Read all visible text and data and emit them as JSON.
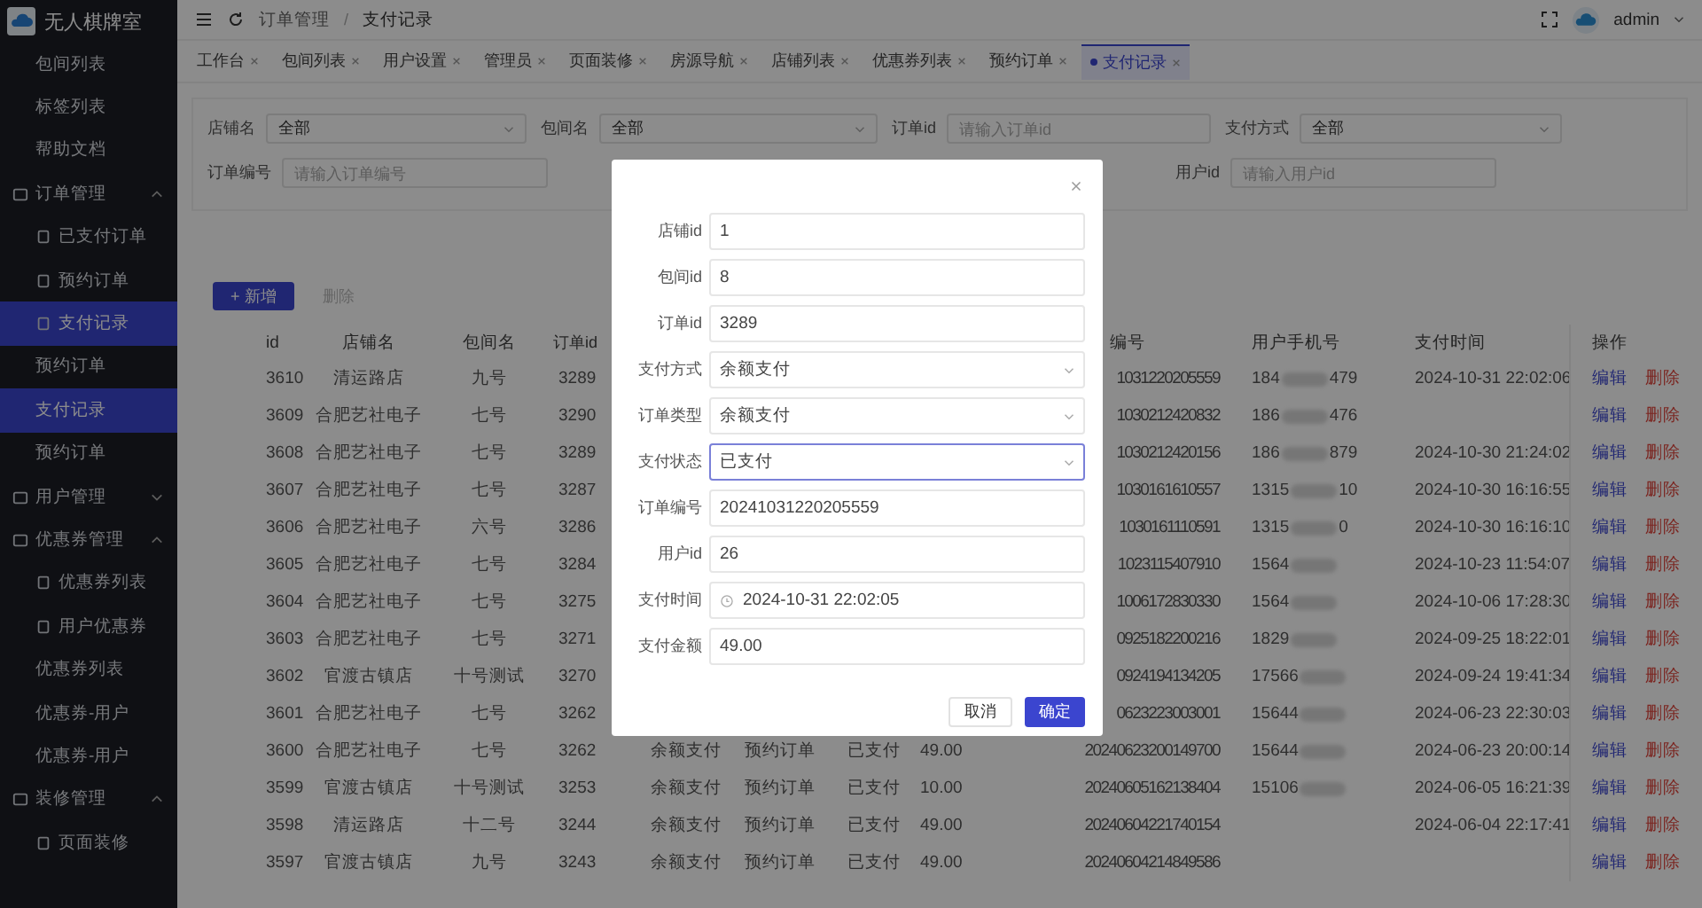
{
  "sidebar": {
    "app_name": "无人棋牌室",
    "items": [
      {
        "label": "包间列表",
        "kind": "link",
        "selected": false
      },
      {
        "label": "标签列表",
        "kind": "link",
        "selected": false
      },
      {
        "label": "帮助文档",
        "kind": "link",
        "selected": false
      },
      {
        "label": "订单管理",
        "kind": "group",
        "expanded": true,
        "selected": false
      },
      {
        "label": "已支付订单",
        "kind": "icon-link",
        "selected": false
      },
      {
        "label": "预约订单",
        "kind": "icon-link",
        "selected": false
      },
      {
        "label": "支付记录",
        "kind": "icon-link",
        "selected": true
      },
      {
        "label": "预约订单",
        "kind": "link",
        "selected": false
      },
      {
        "label": "支付记录",
        "kind": "link",
        "selected": true
      },
      {
        "label": "预约订单",
        "kind": "link",
        "selected": false
      },
      {
        "label": "用户管理",
        "kind": "group",
        "expanded": false,
        "selected": false
      },
      {
        "label": "优惠券管理",
        "kind": "group",
        "expanded": true,
        "selected": false
      },
      {
        "label": "优惠券列表",
        "kind": "icon-link",
        "selected": false
      },
      {
        "label": "用户优惠券",
        "kind": "icon-link",
        "selected": false
      },
      {
        "label": "优惠券列表",
        "kind": "link",
        "selected": false
      },
      {
        "label": "优惠券-用户",
        "kind": "link",
        "selected": false
      },
      {
        "label": "优惠券-用户",
        "kind": "link",
        "selected": false
      },
      {
        "label": "装修管理",
        "kind": "group",
        "expanded": true,
        "selected": false
      },
      {
        "label": "页面装修",
        "kind": "icon-link",
        "selected": false
      }
    ]
  },
  "header": {
    "breadcrumb": [
      "订单管理",
      "支付记录"
    ],
    "breadcrumb_separator": "/",
    "user": "admin"
  },
  "tabs": [
    {
      "label": "工作台",
      "selected": false
    },
    {
      "label": "包间列表",
      "selected": false
    },
    {
      "label": "用户设置",
      "selected": false
    },
    {
      "label": "管理员",
      "selected": false
    },
    {
      "label": "页面装修",
      "selected": false
    },
    {
      "label": "房源导航",
      "selected": false
    },
    {
      "label": "店铺列表",
      "selected": false
    },
    {
      "label": "优惠券列表",
      "selected": false
    },
    {
      "label": "预约订单",
      "selected": false
    },
    {
      "label": "支付记录",
      "selected": true
    }
  ],
  "filters": [
    {
      "label": "店铺名",
      "kind": "select",
      "value": "全部"
    },
    {
      "label": "包间名",
      "kind": "select",
      "value": "全部"
    },
    {
      "label": "订单id",
      "kind": "input",
      "placeholder": "请输入订单id"
    },
    {
      "label": "支付方式",
      "kind": "select",
      "value": "全部"
    },
    {
      "label": "订单编号",
      "kind": "input",
      "placeholder": "请输入订单编号"
    },
    {
      "label": "用户id",
      "kind": "input",
      "placeholder": "请输入用户id"
    }
  ],
  "toolbar": {
    "add": "+ 新增",
    "delete": "删除",
    "delete_disabled": true
  },
  "table": {
    "columns": {
      "id": "id",
      "shop": "店铺名",
      "room": "包间名",
      "order_id": "订单id",
      "order_no": "编号",
      "phone": "用户手机号",
      "pay_time": "支付时间",
      "actions": "操作"
    },
    "rows": [
      {
        "id": "3610",
        "shop": "清运路店",
        "room": "九号",
        "order_id": "3289",
        "order_no": "1031220205559",
        "phone_head": "184",
        "phone_tail": "479",
        "pay_time": "2024-10-31 22:02:06",
        "actions": [
          "编辑",
          "删除"
        ]
      },
      {
        "id": "3609",
        "shop": "合肥艺社电子",
        "room": "七号",
        "order_id": "3290",
        "order_no": "1030212420832",
        "phone_head": "186",
        "phone_tail": "476",
        "actions": [
          "编辑",
          "删除"
        ]
      },
      {
        "id": "3608",
        "shop": "合肥艺社电子",
        "room": "七号",
        "order_id": "3289",
        "order_no": "1030212420156",
        "phone_head": "186",
        "phone_tail": "879",
        "pay_time": "2024-10-30 21:24:02",
        "actions": [
          "编辑",
          "删除"
        ]
      },
      {
        "id": "3607",
        "shop": "合肥艺社电子",
        "room": "七号",
        "order_id": "3287",
        "order_no": "1030161610557",
        "phone_head": "1315",
        "phone_tail": "10",
        "pay_time": "2024-10-30 16:16:55",
        "actions": [
          "编辑",
          "删除"
        ]
      },
      {
        "id": "3606",
        "shop": "合肥艺社电子",
        "room": "六号",
        "order_id": "3286",
        "order_no": "1030161110591",
        "phone_head": "1315",
        "phone_tail": "0",
        "pay_time": "2024-10-30 16:16:10",
        "actions": [
          "编辑",
          "删除"
        ]
      },
      {
        "id": "3605",
        "shop": "合肥艺社电子",
        "room": "七号",
        "order_id": "3284",
        "order_no": "1023115407910",
        "phone_head": "1564",
        "pay_time": "2024-10-23 11:54:07",
        "actions": [
          "编辑",
          "删除"
        ]
      },
      {
        "id": "3604",
        "shop": "合肥艺社电子",
        "room": "七号",
        "order_id": "3275",
        "order_no": "1006172830330",
        "phone_head": "1564",
        "pay_time": "2024-10-06 17:28:30",
        "actions": [
          "编辑",
          "删除"
        ]
      },
      {
        "id": "3603",
        "shop": "合肥艺社电子",
        "room": "七号",
        "order_id": "3271",
        "order_no": "0925182200216",
        "phone_head": "1829",
        "pay_time": "2024-09-25 18:22:01",
        "actions": [
          "编辑",
          "删除"
        ]
      },
      {
        "id": "3602",
        "shop": "官渡古镇店",
        "room": "十号测试",
        "order_id": "3270",
        "order_no": "0924194134205",
        "phone_head": "17566",
        "pay_time": "2024-09-24 19:41:34",
        "actions": [
          "编辑",
          "删除"
        ]
      },
      {
        "id": "3601",
        "shop": "合肥艺社电子",
        "room": "七号",
        "order_id": "3262",
        "order_no": "0623223003001",
        "phone_head": "15644",
        "pay_time": "2024-06-23 22:30:03",
        "actions": [
          "编辑",
          "删除"
        ]
      },
      {
        "id": "3600",
        "shop": "合肥艺社电子",
        "room": "七号",
        "order_id": "3262",
        "method": "余额支付",
        "order_type": "预约订单",
        "status": "已支付",
        "amount": "49.00",
        "order_no": "20240623200149700",
        "phone_head": "15644",
        "pay_time": "2024-06-23 20:00:14",
        "actions": [
          "编辑",
          "删除"
        ]
      },
      {
        "id": "3599",
        "shop": "官渡古镇店",
        "room": "十号测试",
        "order_id": "3253",
        "method": "余额支付",
        "order_type": "预约订单",
        "status": "已支付",
        "amount": "10.00",
        "order_no": "20240605162138404",
        "phone_head": "15106",
        "pay_time": "2024-06-05 16:21:39",
        "actions": [
          "编辑",
          "删除"
        ]
      },
      {
        "id": "3598",
        "shop": "清运路店",
        "room": "十二号",
        "order_id": "3244",
        "method": "余额支付",
        "order_type": "预约订单",
        "status": "已支付",
        "amount": "49.00",
        "order_no": "20240604221740154",
        "pay_time": "2024-06-04 22:17:41",
        "actions": [
          "编辑",
          "删除"
        ]
      },
      {
        "id": "3597",
        "shop": "官渡古镇店",
        "room": "九号",
        "order_id": "3243",
        "method": "余额支付",
        "order_type": "预约订单",
        "status": "已支付",
        "amount": "49.00",
        "order_no": "20240604214849586",
        "actions": [
          "编辑",
          "删除"
        ]
      }
    ]
  },
  "dialog": {
    "fields": [
      {
        "label": "店铺id",
        "kind": "input",
        "value": "1",
        "focused": false
      },
      {
        "label": "包间id",
        "kind": "input",
        "value": "8",
        "focused": false
      },
      {
        "label": "订单id",
        "kind": "input",
        "value": "3289",
        "focused": false
      },
      {
        "label": "支付方式",
        "kind": "select",
        "value": "余额支付",
        "focused": false
      },
      {
        "label": "订单类型",
        "kind": "select",
        "value": "余额支付",
        "focused": false
      },
      {
        "label": "支付状态",
        "kind": "select",
        "value": "已支付",
        "focused": true
      },
      {
        "label": "订单编号",
        "kind": "input",
        "value": "20241031220205559",
        "focused": false
      },
      {
        "label": "用户id",
        "kind": "input",
        "value": "26",
        "focused": false
      },
      {
        "label": "支付时间",
        "kind": "datetime",
        "value": "2024-10-31 22:02:05",
        "focused": false
      },
      {
        "label": "支付金额",
        "kind": "input",
        "value": "49.00",
        "focused": false
      }
    ],
    "cancel": "取消",
    "confirm": "确定"
  }
}
